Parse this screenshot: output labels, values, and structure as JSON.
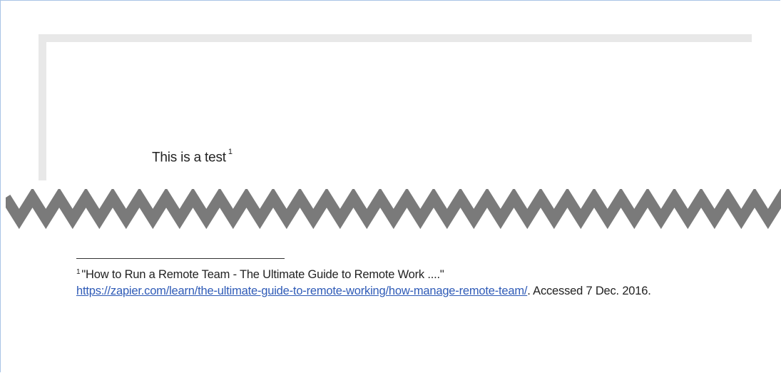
{
  "colors": {
    "page_edge": "#e8e8e8",
    "link": "#2f5bb7",
    "zigzag": "#7a7a7a",
    "frame_border": "#a9c4e6"
  },
  "document": {
    "body_text": "This is a test",
    "body_footnote_ref": "1"
  },
  "footnote": {
    "marker": "1",
    "title": "\"How to Run a Remote Team - The Ultimate Guide to Remote Work ....\"",
    "url": "https://zapier.com/learn/the-ultimate-guide-to-remote-working/how-manage-remote-team/",
    "accessed": ". Accessed 7 Dec. 2016."
  }
}
